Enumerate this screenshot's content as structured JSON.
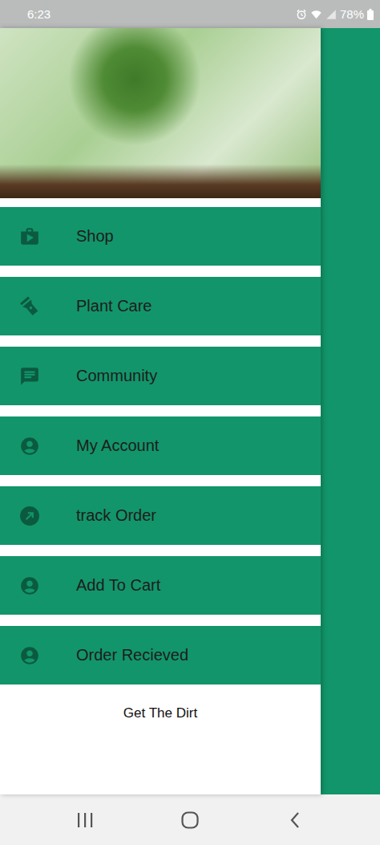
{
  "status_bar": {
    "time": "6:23",
    "battery": "78%"
  },
  "drawer": {
    "items": [
      {
        "label": "Shop"
      },
      {
        "label": "Plant Care"
      },
      {
        "label": "Community"
      },
      {
        "label": "My Account"
      },
      {
        "label": "track Order"
      },
      {
        "label": "Add To Cart"
      },
      {
        "label": "Order Recieved"
      }
    ],
    "footer": "Get The Dirt"
  }
}
